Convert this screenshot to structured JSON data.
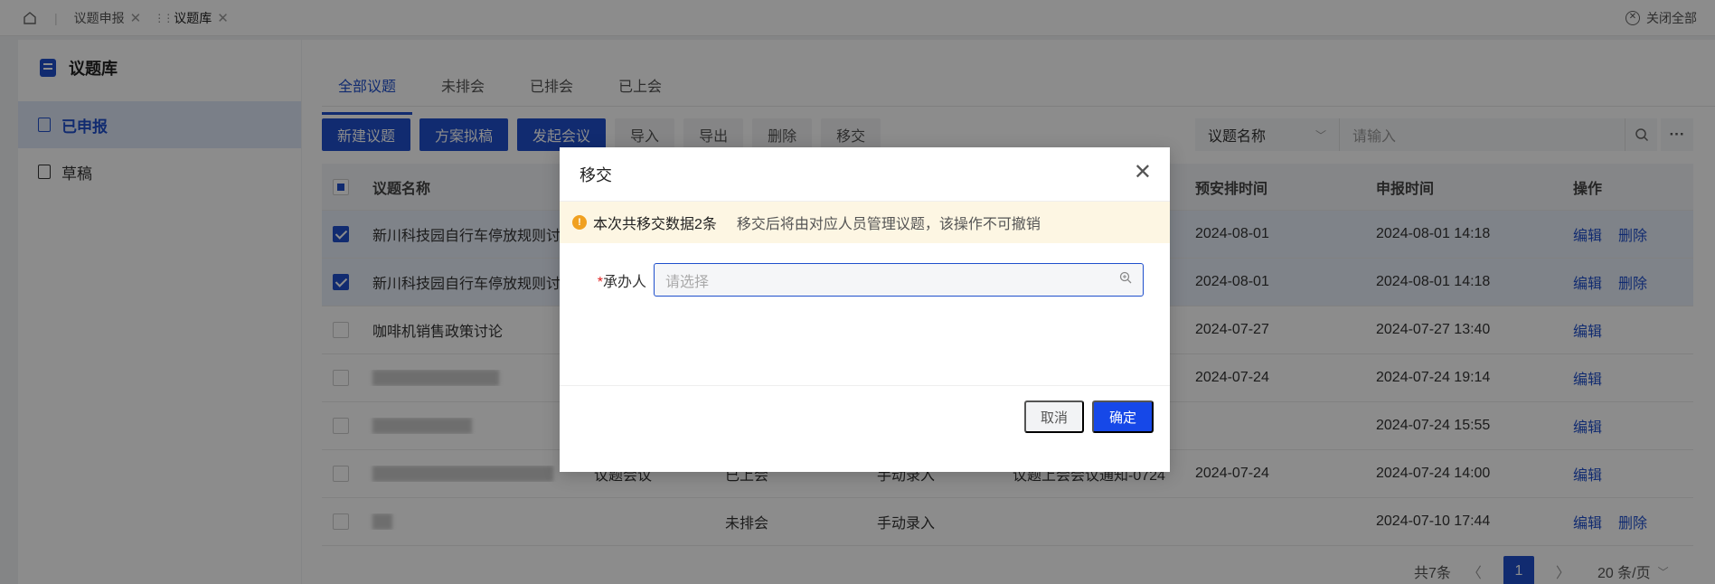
{
  "topbar": {
    "tabs": [
      {
        "label": "议题申报"
      },
      {
        "label": "议题库"
      }
    ],
    "close_all": "关闭全部"
  },
  "sidebar": {
    "title": "议题库",
    "items": [
      {
        "label": "已申报"
      },
      {
        "label": "草稿"
      }
    ]
  },
  "main": {
    "tabs": [
      "全部议题",
      "未排会",
      "已排会",
      "已上会"
    ],
    "toolbar": {
      "primary": [
        "新建议题",
        "方案拟稿",
        "发起会议"
      ],
      "plain": [
        "导入",
        "导出",
        "删除",
        "移交"
      ]
    },
    "search": {
      "field": "议题名称",
      "placeholder": "请输入"
    },
    "table": {
      "headers": [
        "议题名称",
        "预安排时间",
        "申报时间",
        "操作"
      ],
      "rows": [
        {
          "name": "新川科技园自行车停放规则讨...",
          "type": "",
          "status": "",
          "source": "",
          "meeting": "",
          "plan": "2024-08-01",
          "declared": "2024-08-01 14:18",
          "actions": [
            "编辑",
            "删除"
          ]
        },
        {
          "name": "新川科技园自行车停放规则讨...",
          "type": "",
          "status": "",
          "source": "",
          "meeting": "",
          "plan": "2024-08-01",
          "declared": "2024-08-01 14:18",
          "actions": [
            "编辑",
            "删除"
          ]
        },
        {
          "name": "咖啡机销售政策讨论",
          "type": "",
          "status": "",
          "source": "",
          "meeting": "",
          "plan": "2024-07-27",
          "declared": "2024-07-27 13:40",
          "actions": [
            "编辑"
          ]
        },
        {
          "name": "",
          "type": "",
          "status": "",
          "source": "",
          "meeting": "",
          "plan": "2024-07-24",
          "declared": "2024-07-24 19:14",
          "actions": [
            "编辑"
          ]
        },
        {
          "name": "",
          "type": "",
          "status": "",
          "source": "",
          "meeting": "",
          "plan": "",
          "declared": "2024-07-24 15:55",
          "actions": [
            "编辑"
          ]
        },
        {
          "name": "",
          "type": "议题会议",
          "status": "已上会",
          "source": "手动录入",
          "meeting": "议题上会会议通知-0724",
          "plan": "2024-07-24",
          "declared": "2024-07-24 14:00",
          "actions": [
            "编辑"
          ]
        },
        {
          "name": "",
          "type": "",
          "status": "未排会",
          "source": "手动录入",
          "meeting": "",
          "plan": "",
          "declared": "2024-07-10 17:44",
          "actions": [
            "编辑",
            "删除"
          ]
        }
      ]
    },
    "pagination": {
      "total": "共7条",
      "page": "1",
      "size": "20 条/页"
    }
  },
  "modal": {
    "title": "移交",
    "notice_count": "本次共移交数据2条",
    "notice_text": "移交后将由对应人员管理议题，该操作不可撤销",
    "field_label": "承办人",
    "field_placeholder": "请选择",
    "cancel": "取消",
    "ok": "确定"
  },
  "colors": {
    "primary": "#1f4fcc",
    "ok_button": "#1648e8",
    "notice_bg": "#fdf6e3",
    "warning": "#f0a020"
  }
}
